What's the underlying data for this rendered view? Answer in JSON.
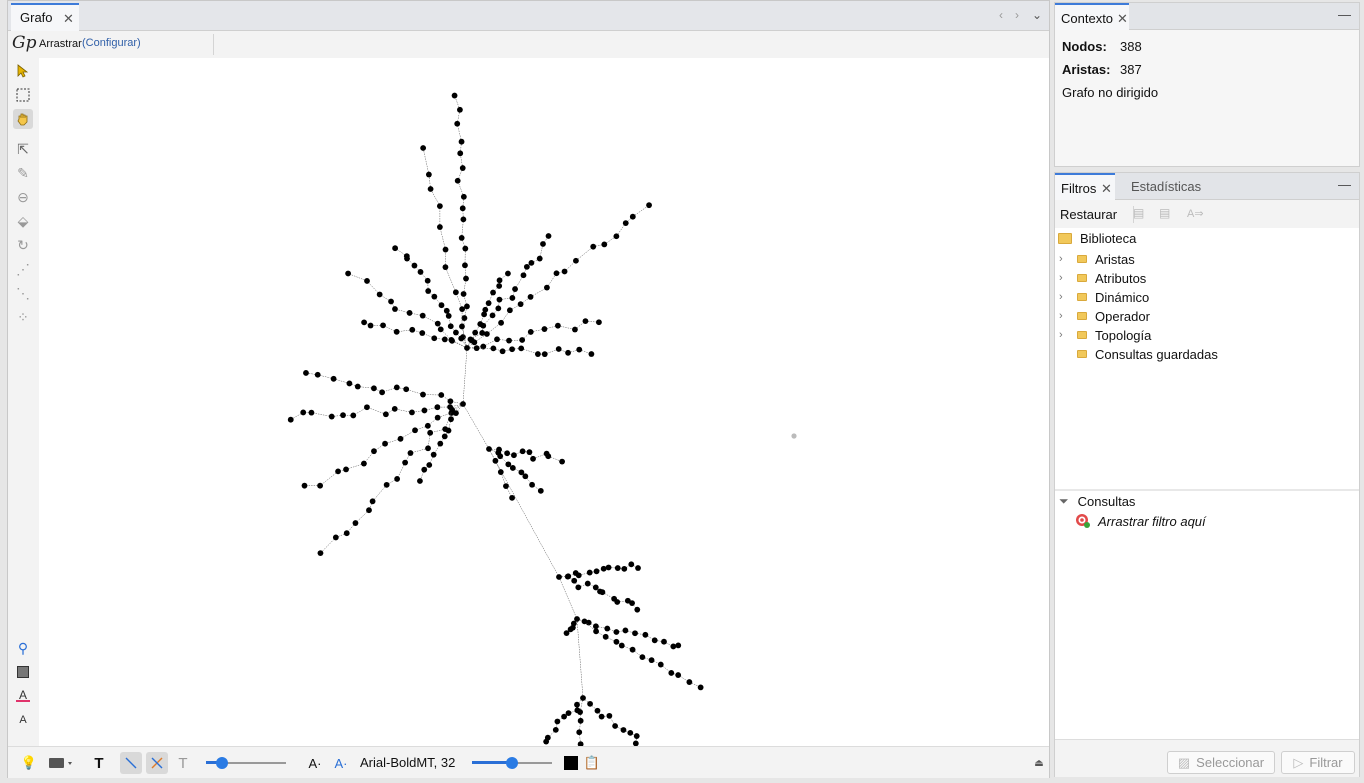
{
  "graph_window": {
    "tab_label": "Grafo",
    "tool_label": "Arrastrar",
    "config_link": "(Configurar)",
    "logo": "Gp"
  },
  "bottom_bar": {
    "font_label": "Arial-BoldMT, 32",
    "node_size_level": 0.2,
    "font_size_level": 0.5
  },
  "context": {
    "tab_label": "Contexto",
    "nodes_label": "Nodos:",
    "nodes_value": "388",
    "edges_label": "Aristas:",
    "edges_value": "387",
    "graph_type": "Grafo no dirigido"
  },
  "filters": {
    "tab_label": "Filtros",
    "stats_tab_label": "Estadísticas",
    "restore_label": "Restaurar",
    "library_label": "Biblioteca",
    "library_items": [
      "Aristas",
      "Atributos",
      "Dinámico",
      "Operador",
      "Topología",
      "Consultas guardadas"
    ],
    "queries_label": "Consultas",
    "drop_hint": "Arrastrar filtro aquí",
    "select_button": "Seleccionar",
    "filter_button": "Filtrar"
  },
  "icons": {
    "left_tools": [
      "pointer-icon",
      "rect-select-icon",
      "drag-hand-icon",
      "edit-icon",
      "brush-icon",
      "size-icon",
      "painter-icon",
      "rotate-icon",
      "add-node-icon",
      "add-edge-icon",
      "shortest-path-icon"
    ],
    "bottom_tools": [
      "zoom-icon",
      "background-color-icon",
      "label-color-icon",
      "label-font-icon"
    ]
  }
}
